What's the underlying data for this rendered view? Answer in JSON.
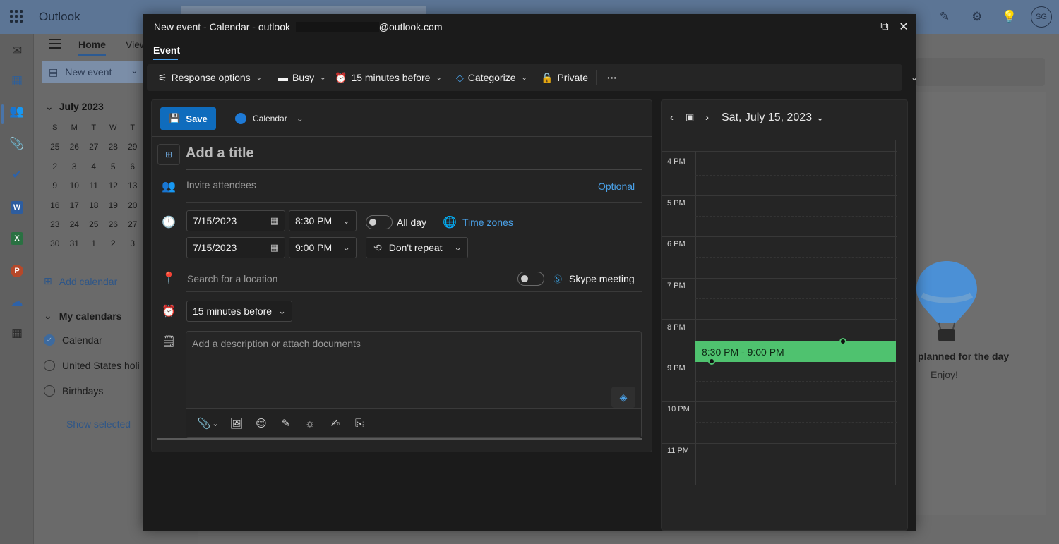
{
  "app": {
    "name": "Outlook",
    "avatar_initials": "SG"
  },
  "bg": {
    "tabs": [
      "Home",
      "View"
    ],
    "new_event_label": "New event",
    "month": "July 2023",
    "weekday_headers": [
      "S",
      "M",
      "T",
      "W",
      "T"
    ],
    "mini_days": [
      "25",
      "26",
      "27",
      "28",
      "29",
      "2",
      "3",
      "4",
      "5",
      "6",
      "9",
      "10",
      "11",
      "12",
      "13",
      "16",
      "17",
      "18",
      "19",
      "20",
      "23",
      "24",
      "25",
      "26",
      "27",
      "30",
      "31",
      "1",
      "2",
      "3"
    ],
    "add_calendar": "Add calendar",
    "my_calendars": "My calendars",
    "calendars": [
      "Calendar",
      "United States holi",
      "Birthdays"
    ],
    "show_selected": "Show selected",
    "planned_text": "planned for the day",
    "enjoy_text": "Enjoy!"
  },
  "modal": {
    "title_prefix": "New event - Calendar - outlook_",
    "title_suffix": "@outlook.com",
    "tab": "Event",
    "ribbon": {
      "response_options": "Response options",
      "busy": "Busy",
      "reminder": "15 minutes before",
      "categorize": "Categorize",
      "private": "Private",
      "more": "···"
    },
    "form": {
      "save": "Save",
      "calendar": "Calendar",
      "title_placeholder": "Add a title",
      "attendees_placeholder": "Invite attendees",
      "optional": "Optional",
      "start_date": "7/15/2023",
      "start_time": "8:30 PM",
      "all_day": "All day",
      "time_zones": "Time zones",
      "end_date": "7/15/2023",
      "end_time": "9:00 PM",
      "repeat": "Don't repeat",
      "location_placeholder": "Search for a location",
      "skype": "Skype meeting",
      "reminder": "15 minutes before",
      "description_placeholder": "Add a description or attach documents"
    },
    "day": {
      "date_label": "Sat, July 15, 2023",
      "hours": [
        "4 PM",
        "5 PM",
        "6 PM",
        "7 PM",
        "8 PM",
        "9 PM",
        "10 PM",
        "11 PM"
      ],
      "event_label": "8:30 PM - 9:00 PM",
      "event_color": "#4fc26f"
    }
  },
  "colors": {
    "accent": "#0f6cbd",
    "link": "#4aa0e6"
  }
}
